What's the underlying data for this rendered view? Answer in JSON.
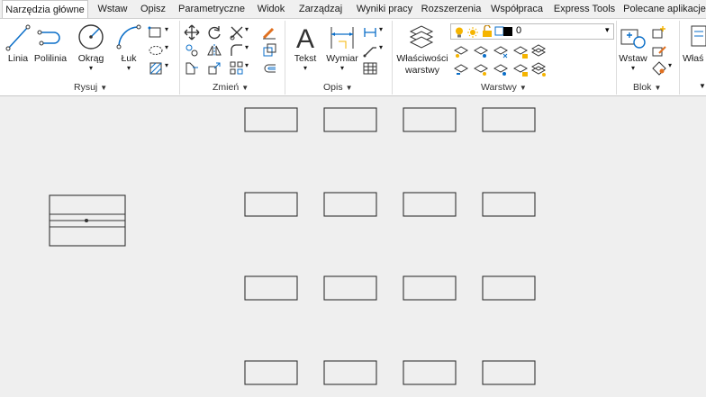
{
  "tabs": [
    {
      "label": "Narzędzia główne",
      "active": true
    },
    {
      "label": "Wstaw"
    },
    {
      "label": "Opisz"
    },
    {
      "label": "Parametryczne"
    },
    {
      "label": "Widok"
    },
    {
      "label": "Zarządzaj"
    },
    {
      "label": "Wyniki pracy"
    },
    {
      "label": "Rozszerzenia"
    },
    {
      "label": "Współpraca"
    },
    {
      "label": "Express Tools"
    },
    {
      "label": "Polecane aplikacje"
    }
  ],
  "panels": {
    "rysuj": {
      "title": "Rysuj",
      "tools": [
        "Linia",
        "Polilinia",
        "Okrąg",
        "Łuk"
      ]
    },
    "zmien": {
      "title": "Zmień"
    },
    "opis": {
      "title": "Opis",
      "tools": [
        "Tekst",
        "Wymiar"
      ]
    },
    "warstwy": {
      "title": "Warstwy",
      "properties_line1": "Właściwości",
      "properties_line2": "warstwy",
      "current_layer": "0"
    },
    "blok": {
      "title": "Blok",
      "insert": "Wstaw"
    },
    "wlasciwosci": {
      "partial_label": "Właś"
    }
  },
  "colors": {
    "accent": "#0a6ec8",
    "layer_bulb": "#f5b400",
    "tab_active_bg": "#ffffff"
  }
}
